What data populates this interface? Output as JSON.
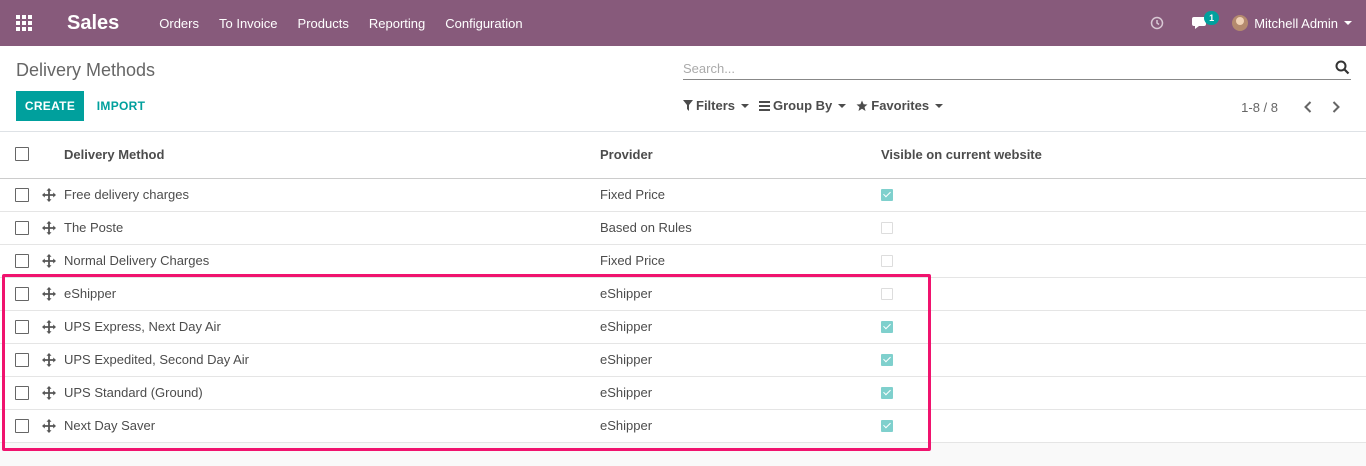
{
  "navbar": {
    "app_name": "Sales",
    "menu": [
      "Orders",
      "To Invoice",
      "Products",
      "Reporting",
      "Configuration"
    ],
    "chat_count": "1",
    "user_name": "Mitchell Admin",
    "color": "#875a7b"
  },
  "control_panel": {
    "title": "Delivery Methods",
    "search_placeholder": "Search...",
    "create_label": "CREATE",
    "import_label": "IMPORT",
    "filters_label": "Filters",
    "group_by_label": "Group By",
    "favorites_label": "Favorites",
    "pager": "1-8 / 8",
    "accent": "#00a09d"
  },
  "table": {
    "columns": [
      "Delivery Method",
      "Provider",
      "Visible on current website"
    ],
    "rows": [
      {
        "name": "Free delivery charges",
        "provider": "Fixed Price",
        "visible": true
      },
      {
        "name": "The Poste",
        "provider": "Based on Rules",
        "visible": false
      },
      {
        "name": "Normal Delivery Charges",
        "provider": "Fixed Price",
        "visible": false
      },
      {
        "name": "eShipper",
        "provider": "eShipper",
        "visible": false
      },
      {
        "name": "UPS Express, Next Day Air",
        "provider": "eShipper",
        "visible": true
      },
      {
        "name": "UPS Expedited, Second Day Air",
        "provider": "eShipper",
        "visible": true
      },
      {
        "name": "UPS Standard (Ground)",
        "provider": "eShipper",
        "visible": true
      },
      {
        "name": "Next Day Saver",
        "provider": "eShipper",
        "visible": true
      }
    ]
  },
  "highlight_color": "#f0136e"
}
